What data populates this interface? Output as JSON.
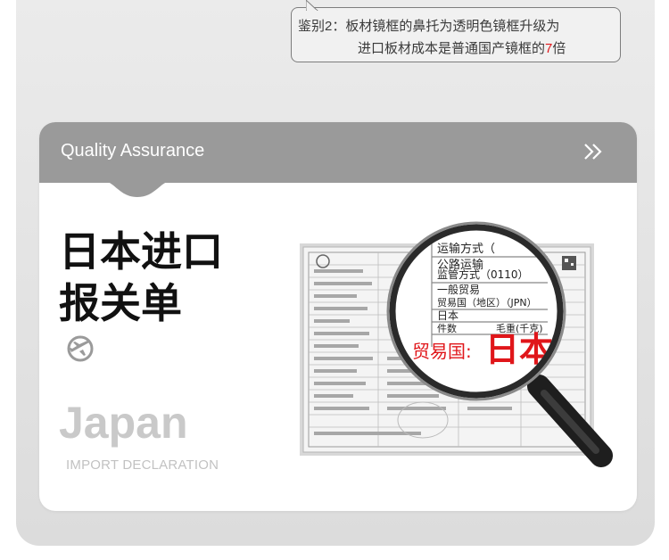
{
  "note": {
    "line1": "鉴别2：板材镜框的鼻托为透明色镜框升级为",
    "line2_prefix": "进口板材成本是普通国产镜框的",
    "line2_highlight": "7",
    "line2_suffix": "倍"
  },
  "card": {
    "header_title": "Quality Assurance",
    "title_line1": "日本进口",
    "title_line2": "报关单",
    "en_title": "Japan",
    "en_subtitle": "IMPORT DECLARATION"
  },
  "document": {
    "lens_rows": [
      "运输方式（",
      "公路运输",
      "监管方式（0110）",
      "一般贸易",
      "贸易国（地区）（JPN）",
      "日本",
      "件数",
      "毛重(千克)"
    ],
    "trade_label": "贸易国:",
    "trade_value": "日本"
  },
  "icons": {
    "header_chevron": "double-chevron-right-icon",
    "plane": "airplane-icon",
    "magnifier": "magnifying-glass-icon"
  },
  "colors": {
    "header_bg": "#9a9a9a",
    "highlight_red": "#e0161a"
  }
}
